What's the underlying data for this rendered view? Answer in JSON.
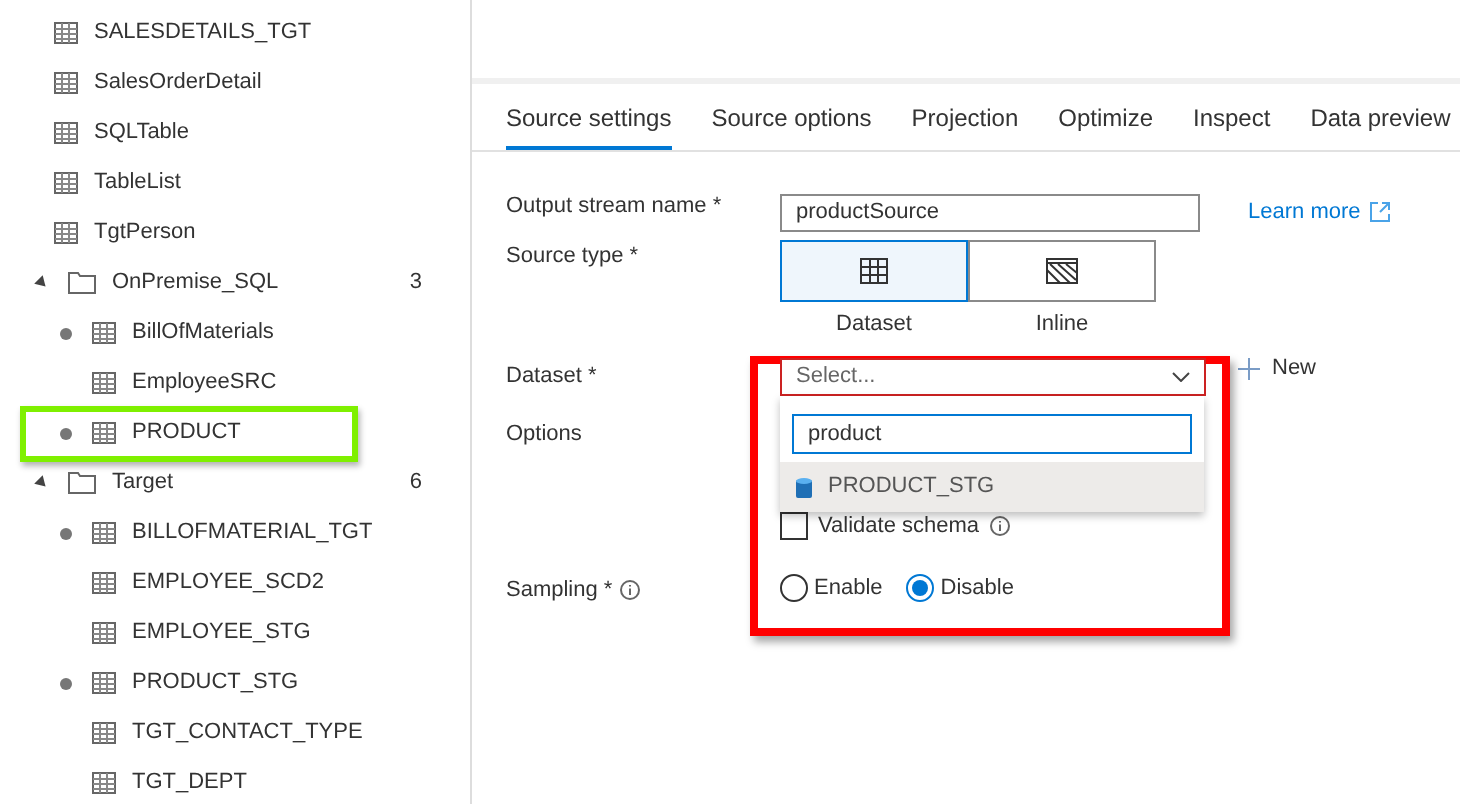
{
  "sidebar": {
    "items": [
      {
        "kind": "table",
        "label": "SALESDETAILS_TGT",
        "modified": false,
        "highlighted": false
      },
      {
        "kind": "table",
        "label": "SalesOrderDetail",
        "modified": false,
        "highlighted": false
      },
      {
        "kind": "table",
        "label": "SQLTable",
        "modified": false,
        "highlighted": false
      },
      {
        "kind": "table",
        "label": "TableList",
        "modified": false,
        "highlighted": false
      },
      {
        "kind": "table",
        "label": "TgtPerson",
        "modified": false,
        "highlighted": false
      },
      {
        "kind": "folder",
        "label": "OnPremise_SQL",
        "count": "3",
        "expanded": true,
        "children": [
          {
            "kind": "table",
            "label": "BillOfMaterials",
            "modified": true,
            "highlighted": false
          },
          {
            "kind": "table",
            "label": "EmployeeSRC",
            "modified": false,
            "highlighted": false
          },
          {
            "kind": "table",
            "label": "PRODUCT",
            "modified": true,
            "highlighted": true
          }
        ]
      },
      {
        "kind": "folder",
        "label": "Target",
        "count": "6",
        "expanded": true,
        "children": [
          {
            "kind": "table",
            "label": "BILLOFMATERIAL_TGT",
            "modified": true,
            "highlighted": false
          },
          {
            "kind": "table",
            "label": "EMPLOYEE_SCD2",
            "modified": false,
            "highlighted": false
          },
          {
            "kind": "table",
            "label": "EMPLOYEE_STG",
            "modified": false,
            "highlighted": false
          },
          {
            "kind": "table",
            "label": "PRODUCT_STG",
            "modified": true,
            "highlighted": false
          },
          {
            "kind": "table",
            "label": "TGT_CONTACT_TYPE",
            "modified": false,
            "highlighted": false
          },
          {
            "kind": "table",
            "label": "TGT_DEPT",
            "modified": false,
            "highlighted": false
          }
        ]
      }
    ]
  },
  "tabs": [
    {
      "label": "Source settings",
      "selected": true
    },
    {
      "label": "Source options",
      "selected": false
    },
    {
      "label": "Projection",
      "selected": false
    },
    {
      "label": "Optimize",
      "selected": false
    },
    {
      "label": "Inspect",
      "selected": false
    },
    {
      "label": "Data preview",
      "selected": false
    }
  ],
  "form": {
    "output_stream": {
      "label": "Output stream name *",
      "value": "productSource",
      "link": "Learn more"
    },
    "source_type": {
      "label": "Source type *",
      "options": [
        {
          "kind": "dataset",
          "label": "Dataset",
          "selected": true
        },
        {
          "kind": "inline",
          "label": "Inline",
          "selected": false
        }
      ]
    },
    "dataset": {
      "label": "Dataset *",
      "placeholder": "Select...",
      "new_label": "New",
      "dropdown": {
        "search_value": "product",
        "options": [
          {
            "label": "PRODUCT_STG",
            "hovered": true
          }
        ]
      }
    },
    "options": {
      "label": "Options",
      "validate_schema": {
        "label": "Validate schema",
        "checked": false
      }
    },
    "sampling": {
      "label": "Sampling *",
      "options": [
        {
          "label": "Enable",
          "selected": false
        },
        {
          "label": "Disable",
          "selected": true
        }
      ]
    }
  }
}
